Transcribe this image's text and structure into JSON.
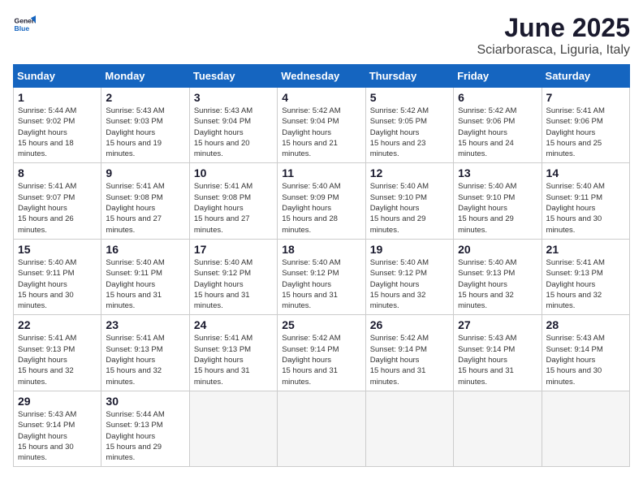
{
  "logo": {
    "line1": "General",
    "line2": "Blue"
  },
  "title": "June 2025",
  "subtitle": "Sciarborasca, Liguria, Italy",
  "weekdays": [
    "Sunday",
    "Monday",
    "Tuesday",
    "Wednesday",
    "Thursday",
    "Friday",
    "Saturday"
  ],
  "weeks": [
    [
      {
        "day": "1",
        "sunrise": "5:44 AM",
        "sunset": "9:02 PM",
        "daylight": "15 hours and 18 minutes."
      },
      {
        "day": "2",
        "sunrise": "5:43 AM",
        "sunset": "9:03 PM",
        "daylight": "15 hours and 19 minutes."
      },
      {
        "day": "3",
        "sunrise": "5:43 AM",
        "sunset": "9:04 PM",
        "daylight": "15 hours and 20 minutes."
      },
      {
        "day": "4",
        "sunrise": "5:42 AM",
        "sunset": "9:04 PM",
        "daylight": "15 hours and 21 minutes."
      },
      {
        "day": "5",
        "sunrise": "5:42 AM",
        "sunset": "9:05 PM",
        "daylight": "15 hours and 23 minutes."
      },
      {
        "day": "6",
        "sunrise": "5:42 AM",
        "sunset": "9:06 PM",
        "daylight": "15 hours and 24 minutes."
      },
      {
        "day": "7",
        "sunrise": "5:41 AM",
        "sunset": "9:06 PM",
        "daylight": "15 hours and 25 minutes."
      }
    ],
    [
      {
        "day": "8",
        "sunrise": "5:41 AM",
        "sunset": "9:07 PM",
        "daylight": "15 hours and 26 minutes."
      },
      {
        "day": "9",
        "sunrise": "5:41 AM",
        "sunset": "9:08 PM",
        "daylight": "15 hours and 27 minutes."
      },
      {
        "day": "10",
        "sunrise": "5:41 AM",
        "sunset": "9:08 PM",
        "daylight": "15 hours and 27 minutes."
      },
      {
        "day": "11",
        "sunrise": "5:40 AM",
        "sunset": "9:09 PM",
        "daylight": "15 hours and 28 minutes."
      },
      {
        "day": "12",
        "sunrise": "5:40 AM",
        "sunset": "9:10 PM",
        "daylight": "15 hours and 29 minutes."
      },
      {
        "day": "13",
        "sunrise": "5:40 AM",
        "sunset": "9:10 PM",
        "daylight": "15 hours and 29 minutes."
      },
      {
        "day": "14",
        "sunrise": "5:40 AM",
        "sunset": "9:11 PM",
        "daylight": "15 hours and 30 minutes."
      }
    ],
    [
      {
        "day": "15",
        "sunrise": "5:40 AM",
        "sunset": "9:11 PM",
        "daylight": "15 hours and 30 minutes."
      },
      {
        "day": "16",
        "sunrise": "5:40 AM",
        "sunset": "9:11 PM",
        "daylight": "15 hours and 31 minutes."
      },
      {
        "day": "17",
        "sunrise": "5:40 AM",
        "sunset": "9:12 PM",
        "daylight": "15 hours and 31 minutes."
      },
      {
        "day": "18",
        "sunrise": "5:40 AM",
        "sunset": "9:12 PM",
        "daylight": "15 hours and 31 minutes."
      },
      {
        "day": "19",
        "sunrise": "5:40 AM",
        "sunset": "9:12 PM",
        "daylight": "15 hours and 32 minutes."
      },
      {
        "day": "20",
        "sunrise": "5:40 AM",
        "sunset": "9:13 PM",
        "daylight": "15 hours and 32 minutes."
      },
      {
        "day": "21",
        "sunrise": "5:41 AM",
        "sunset": "9:13 PM",
        "daylight": "15 hours and 32 minutes."
      }
    ],
    [
      {
        "day": "22",
        "sunrise": "5:41 AM",
        "sunset": "9:13 PM",
        "daylight": "15 hours and 32 minutes."
      },
      {
        "day": "23",
        "sunrise": "5:41 AM",
        "sunset": "9:13 PM",
        "daylight": "15 hours and 32 minutes."
      },
      {
        "day": "24",
        "sunrise": "5:41 AM",
        "sunset": "9:13 PM",
        "daylight": "15 hours and 31 minutes."
      },
      {
        "day": "25",
        "sunrise": "5:42 AM",
        "sunset": "9:14 PM",
        "daylight": "15 hours and 31 minutes."
      },
      {
        "day": "26",
        "sunrise": "5:42 AM",
        "sunset": "9:14 PM",
        "daylight": "15 hours and 31 minutes."
      },
      {
        "day": "27",
        "sunrise": "5:43 AM",
        "sunset": "9:14 PM",
        "daylight": "15 hours and 31 minutes."
      },
      {
        "day": "28",
        "sunrise": "5:43 AM",
        "sunset": "9:14 PM",
        "daylight": "15 hours and 30 minutes."
      }
    ],
    [
      {
        "day": "29",
        "sunrise": "5:43 AM",
        "sunset": "9:14 PM",
        "daylight": "15 hours and 30 minutes."
      },
      {
        "day": "30",
        "sunrise": "5:44 AM",
        "sunset": "9:13 PM",
        "daylight": "15 hours and 29 minutes."
      },
      null,
      null,
      null,
      null,
      null
    ]
  ],
  "labels": {
    "sunrise": "Sunrise:",
    "sunset": "Sunset:",
    "daylight": "Daylight hours"
  }
}
